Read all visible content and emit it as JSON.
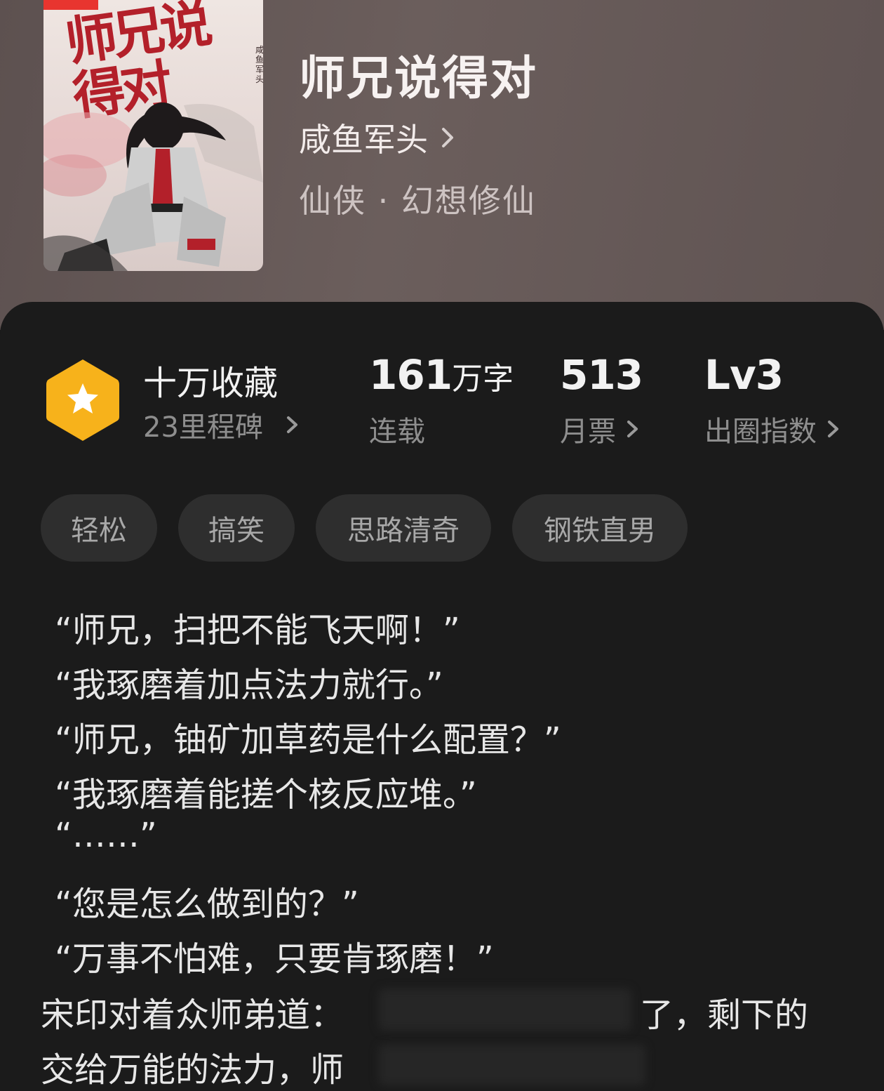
{
  "book": {
    "title": "师兄说得对",
    "author": "咸鱼军头",
    "genre": "仙侠 · 幻想修仙",
    "cover": {
      "title_text": "师兄说\n得对",
      "author_text": "咸鱼军头"
    }
  },
  "stats": {
    "collection": {
      "title": "十万收藏",
      "subtitle": "23里程碑",
      "icon": "star-hexagon-icon",
      "icon_color": "#f7b21b"
    },
    "words": {
      "value": "161",
      "unit": "万字",
      "label": "连载"
    },
    "monthly_tickets": {
      "value": "513",
      "label": "月票"
    },
    "popularity": {
      "value": "Lv3",
      "label": "出圈指数"
    }
  },
  "tags": [
    "轻松",
    "搞笑",
    "思路清奇",
    "钢铁直男"
  ],
  "synopsis": {
    "lines": [
      "“师兄，扫把不能飞天啊！”",
      "“我琢磨着加点法力就行。”",
      "“师兄，铀矿加草药是什么配置？”",
      "“我琢磨着能搓个核反应堆。”",
      "“……”",
      "“您是怎么做到的？”",
      "“万事不怕难，只要肯琢磨！”"
    ],
    "para_line1_start": "宋印对着众师弟道：",
    "para_line1_end": "了，剩下的",
    "para_line2_start": "交给万能的法力，师"
  },
  "colors": {
    "panel_bg": "#1b1b1b",
    "header_bg": "#615554",
    "tag_bg": "#2e2e2e",
    "accent": "#f7b21b"
  }
}
